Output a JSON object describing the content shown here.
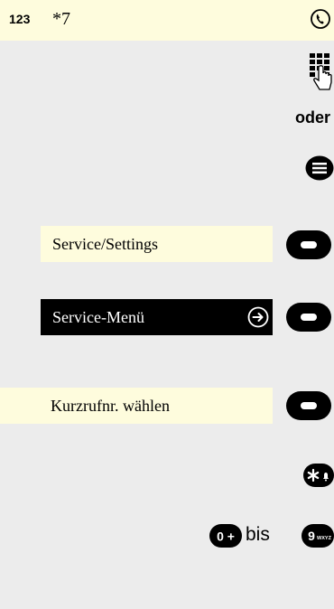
{
  "header": {
    "number_label": "123",
    "dialed_digits": "*7",
    "call_icon": "phone-handset-icon"
  },
  "instructions": {
    "keypad_icon": "dialpad-press-icon",
    "or_label": "oder",
    "menu_icon": "menu-key-icon"
  },
  "menu": {
    "item_1": "Service/Settings",
    "item_2": "Service-Menü",
    "item_2_icon": "arrow-right-icon",
    "item_3": "Kurzrufnr. wählen"
  },
  "keys": {
    "star_label": "*",
    "zero_label": "0 +",
    "range_word": "bis",
    "nine_label": "9",
    "nine_sub": "WXYZ"
  },
  "colors": {
    "background": "#ececec",
    "highlight_bar": "#fefcdd",
    "selected_bar": "#000000"
  }
}
